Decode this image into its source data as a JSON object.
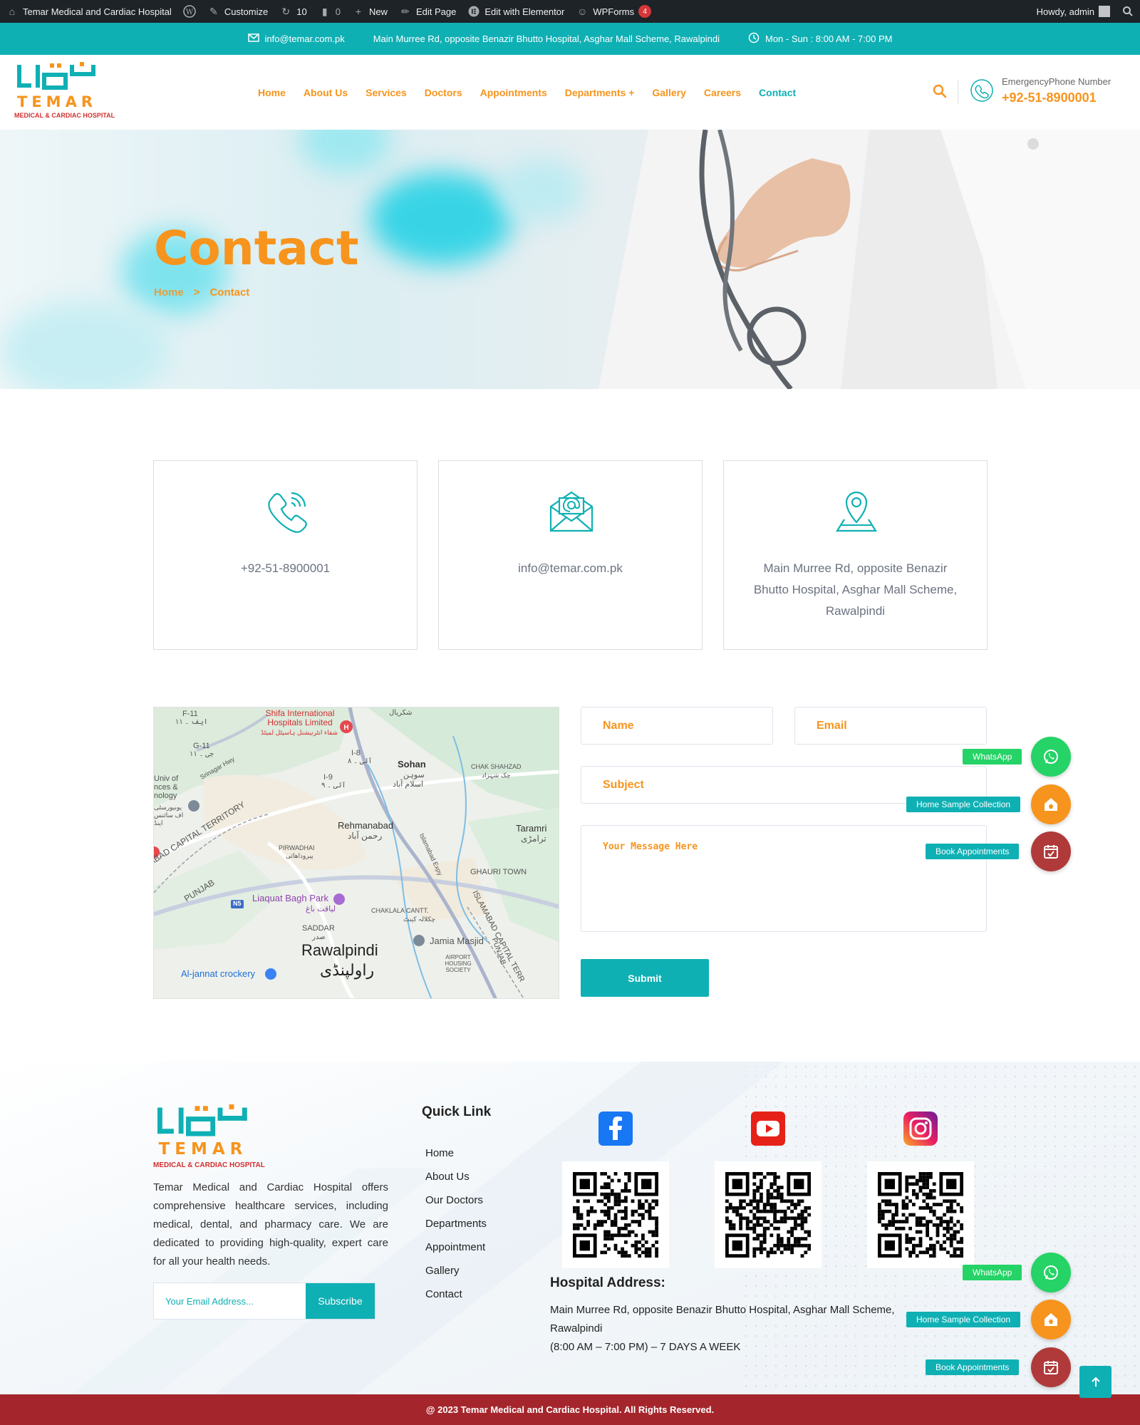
{
  "adminbar": {
    "site_name": "Temar Medical and Cardiac Hospital",
    "customize": "Customize",
    "updates": "10",
    "comments": "0",
    "new": "New",
    "edit_page": "Edit Page",
    "elementor": "Edit with Elementor",
    "wpforms": "WPForms",
    "wpforms_badge": "4",
    "howdy": "Howdy, admin"
  },
  "topbar": {
    "email": "info@temar.com.pk",
    "address": "Main Murree Rd, opposite Benazir Bhutto Hospital, Asghar Mall Scheme, Rawalpindi",
    "hours": "Mon - Sun : 8:00 AM - 7:00 PM"
  },
  "logo": {
    "name": "TEMAR",
    "sub": "MEDICAL & CARDIAC HOSPITAL"
  },
  "nav": {
    "items": [
      "Home",
      "About Us",
      "Services",
      "Doctors",
      "Appointments",
      "Departments +",
      "Gallery",
      "Careers",
      "Contact"
    ],
    "active": "Contact"
  },
  "emergency": {
    "label": "EmergencyPhone Number",
    "phone": "+92-51-8900001"
  },
  "hero": {
    "title": "Contact",
    "crumb_home": "Home",
    "crumb_sep": ">",
    "crumb_current": "Contact"
  },
  "cards": {
    "phone": "+92-51-8900001",
    "email": "info@temar.com.pk",
    "address": "Main Murree Rd, opposite Benazir Bhutto Hospital, Asghar Mall Scheme, Rawalpindi"
  },
  "map": {
    "labels": {
      "f11": "F-11",
      "f11_ur": "ایف ۔ ۱۱",
      "g11": "G-11",
      "g11_ur": "جی ۔ ۱۱",
      "shifa": "Shifa International Hospitals Limited",
      "shifa_ur": "شفاء انٹرنیشنل ہاسپٹل لمیٹڈ",
      "i8": "I-8",
      "i8_ur": "آئی ۔ ۸",
      "i9": "I-9",
      "i9_ur": "آئی ۔ ۹",
      "sohan": "Sohan",
      "sohan_ur": "سوہن",
      "islamabad_ur": "اسلام آباد",
      "shakrial_ur": "شکریال",
      "chak_shahzad": "CHAK SHAHZAD",
      "chak_shahzad_ur": "چک شہزاد",
      "univ": "Univ of nces & nology",
      "univ_ur": "یونیورسٹی اف سائنس اینڈ",
      "srinagar": "Srinagar Hwy",
      "rehmanabad": "Rehmanabad",
      "rehmanabad_ur": "رحمن آباد",
      "taramri": "Taramri",
      "taramri_ur": "ترامڑی",
      "pirwadhai": "PIRWADHAI",
      "pirwadhai_ur": "پیروداھائی",
      "territory": "ABAD CAPITAL TERRITORY",
      "punjab": "PUNJAB",
      "expy": "Islamabad Expy",
      "ghauri": "GHAURI TOWN",
      "liaquat": "Liaquat Bagh Park",
      "liaquat_ur": "لیاقت باغ",
      "n5": "N5",
      "chaklala": "CHAKLALA CANTT.",
      "chaklala_ur": "چکلالہ کینٹ",
      "saddar": "SADDAR",
      "saddar_ur": "صدر",
      "jamia": "Jamia Masjid",
      "rawalpindi": "Rawalpindi",
      "rawalpindi_ur": "راولپنڈی",
      "aljannat": "Al-jannat crockery",
      "airport": "AIRPORT HOUSING SOCIETY",
      "territory2": "ISLAMABAD CAPITAL TERR",
      "punjab2": "PUNJAB"
    }
  },
  "form": {
    "name": "Name",
    "email": "Email",
    "subject": "Subject",
    "message": "Your Message Here",
    "submit": "Submit"
  },
  "floating": {
    "whatsapp": "WhatsApp",
    "home_sample": "Home Sample Collection",
    "book": "Book Appointments"
  },
  "footer": {
    "about": "Temar Medical and Cardiac Hospital offers comprehensive healthcare services, including medical, dental, and pharmacy care. We are dedicated to providing high-quality, expert care for all your health needs.",
    "email_placeholder": "Your Email Address...",
    "subscribe": "Subscribe",
    "quick_link_title": "Quick Link",
    "quick_links": [
      "Home",
      "About Us",
      "Our Doctors",
      "Departments",
      "Appointment",
      "Gallery",
      "Contact"
    ],
    "address_title": "Hospital Address:",
    "address_line1": "Main Murree Rd, opposite Benazir Bhutto Hospital, Asghar Mall Scheme,",
    "address_line2": "Rawalpindi",
    "address_line3": "(8:00 AM – 7:00 PM) – 7 DAYS A WEEK"
  },
  "copyright": "@ 2023 Temar Medical and Cardiac Hospital. All Rights Reserved.",
  "colors": {
    "teal": "#0fb0b4",
    "orange": "#f7941d",
    "maroon": "#a4262c",
    "green": "#25d366",
    "red_fab": "#b03a3a"
  },
  "icons": [
    "home-icon",
    "wordpress-icon",
    "brush-icon",
    "updates-icon",
    "comment-icon",
    "plus-icon",
    "pencil-icon",
    "elementor-icon",
    "wpforms-icon",
    "envelope-icon",
    "clock-icon",
    "search-icon",
    "phone-icon",
    "location-icon",
    "whatsapp-icon",
    "home-collection-icon",
    "calendar-icon",
    "facebook-icon",
    "youtube-icon",
    "instagram-icon",
    "arrow-up-icon"
  ]
}
